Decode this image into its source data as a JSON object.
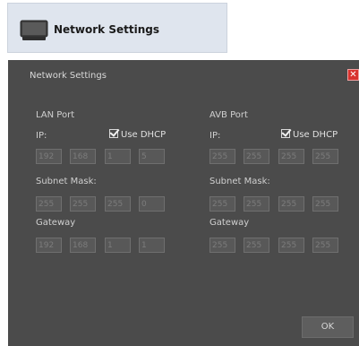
{
  "header": {
    "title": "Network Settings",
    "icon": "monitor-icon"
  },
  "dialog": {
    "title": "Network Settings",
    "close_icon": "close-icon",
    "close_color": "#d8322e",
    "lan": {
      "title": "LAN Port",
      "ip_label": "IP:",
      "dhcp_label": "Use DHCP",
      "dhcp_checked": true,
      "ip": [
        "192",
        "168",
        "1",
        "5"
      ],
      "mask_label": "Subnet Mask:",
      "mask": [
        "255",
        "255",
        "255",
        "0"
      ],
      "gateway_label": "Gateway",
      "gateway": [
        "192",
        "168",
        "1",
        "1"
      ]
    },
    "avb": {
      "title": "AVB Port",
      "ip_label": "IP:",
      "dhcp_label": "Use DHCP",
      "dhcp_checked": true,
      "ip": [
        "255",
        "255",
        "255",
        "255"
      ],
      "mask_label": "Subnet Mask:",
      "mask": [
        "255",
        "255",
        "255",
        "255"
      ],
      "gateway_label": "Gateway",
      "gateway": [
        "255",
        "255",
        "255",
        "255"
      ]
    },
    "ok_label": "OK"
  }
}
